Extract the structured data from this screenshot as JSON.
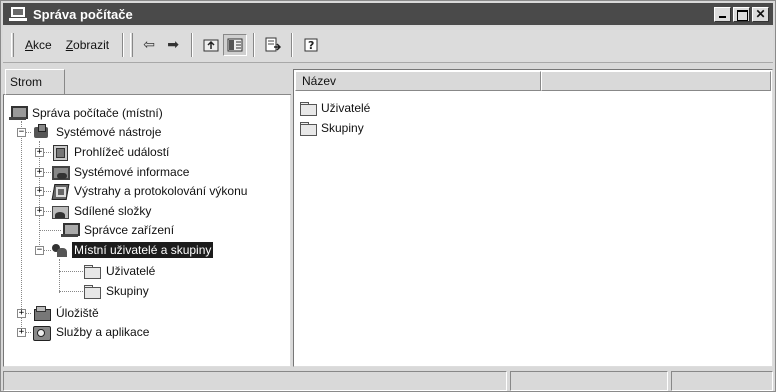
{
  "window": {
    "title": "Správa počítače"
  },
  "toolbar": {
    "menu_action": "Akce",
    "menu_action_key": "A",
    "menu_action_rest": "kce",
    "menu_view_key": "Z",
    "menu_view_rest": "obrazit",
    "back_glyph": "⇦",
    "forward_glyph": "➡",
    "icons": [
      "back-arrow-icon",
      "forward-arrow-icon",
      "up-level-icon",
      "show-hide-tree-icon",
      "export-list-icon",
      "help-icon"
    ]
  },
  "tree_pane": {
    "tab_label": "Strom",
    "items": [
      {
        "label": "Správa počítače (místní)",
        "icon": "computer-icon"
      },
      {
        "label": "Systémové nástroje",
        "icon": "system-tools-icon",
        "expander": "−"
      },
      {
        "label": "Prohlížeč událostí",
        "icon": "event-viewer-icon",
        "expander": "+"
      },
      {
        "label": "Systémové informace",
        "icon": "system-info-icon",
        "expander": "+"
      },
      {
        "label": "Výstrahy a protokolování výkonu",
        "icon": "performance-alerts-icon",
        "expander": "+"
      },
      {
        "label": "Sdílené složky",
        "icon": "shared-folders-icon",
        "expander": "+"
      },
      {
        "label": "Správce zařízení",
        "icon": "device-manager-icon"
      },
      {
        "label": "Místní uživatelé a skupiny",
        "icon": "local-users-groups-icon",
        "expander": "−",
        "selected": true
      },
      {
        "label": "Uživatelé",
        "icon": "folder-icon"
      },
      {
        "label": "Skupiny",
        "icon": "folder-icon"
      },
      {
        "label": "Úložiště",
        "icon": "storage-icon",
        "expander": "+"
      },
      {
        "label": "Služby a aplikace",
        "icon": "services-apps-icon",
        "expander": "+"
      }
    ]
  },
  "list_pane": {
    "column_header": "Název",
    "items": [
      {
        "label": "Uživatelé",
        "icon": "folder-icon"
      },
      {
        "label": "Skupiny",
        "icon": "folder-icon"
      }
    ]
  },
  "colors": {
    "titlebar": "#4a4a4a",
    "selection": "#1c1c1c",
    "face": "#d9d9d9"
  }
}
